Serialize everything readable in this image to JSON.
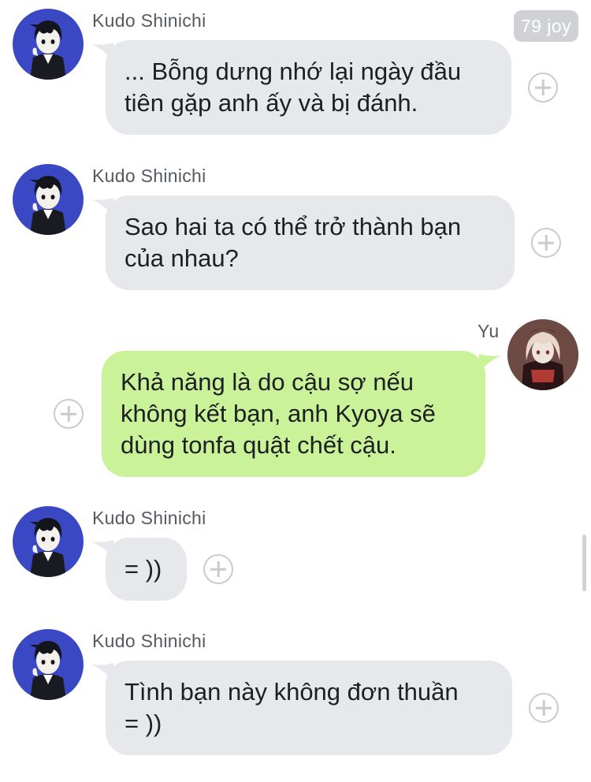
{
  "badge": {
    "text": "79 joy"
  },
  "messages": [
    {
      "sender": "Kudo Shinichi",
      "direction": "incoming",
      "text": "... Bỗng dưng nhớ lại ngày đầu\ntiên gặp anh ấy và bị đánh.",
      "avatar_icon": "anime-boy-avatar",
      "action_icon": "add-reaction-icon"
    },
    {
      "sender": "Kudo Shinichi",
      "direction": "incoming",
      "text": "Sao hai ta có thể trở thành bạn\ncủa nhau?",
      "avatar_icon": "anime-boy-avatar",
      "action_icon": "add-reaction-icon"
    },
    {
      "sender": "Yu",
      "direction": "outgoing",
      "text": "Khả năng là do cậu sợ nếu\nkhông kết bạn, anh Kyoya sẽ\ndùng tonfa quật chết cậu.",
      "avatar_icon": "anime-girl-avatar",
      "action_icon": "add-reaction-icon"
    },
    {
      "sender": "Kudo Shinichi",
      "direction": "incoming",
      "text": "= ))",
      "avatar_icon": "anime-boy-avatar",
      "action_icon": "add-reaction-icon"
    },
    {
      "sender": "Kudo Shinichi",
      "direction": "incoming",
      "text": "Tình bạn này không đơn thuần\n= ))",
      "avatar_icon": "anime-boy-avatar",
      "action_icon": "add-reaction-icon"
    }
  ],
  "colors": {
    "incoming_bubble": "#e6e8eb",
    "outgoing_bubble": "#c9f299",
    "boy_avatar_bg": "#3b48c4",
    "girl_avatar_bg": "#5a3a38"
  }
}
